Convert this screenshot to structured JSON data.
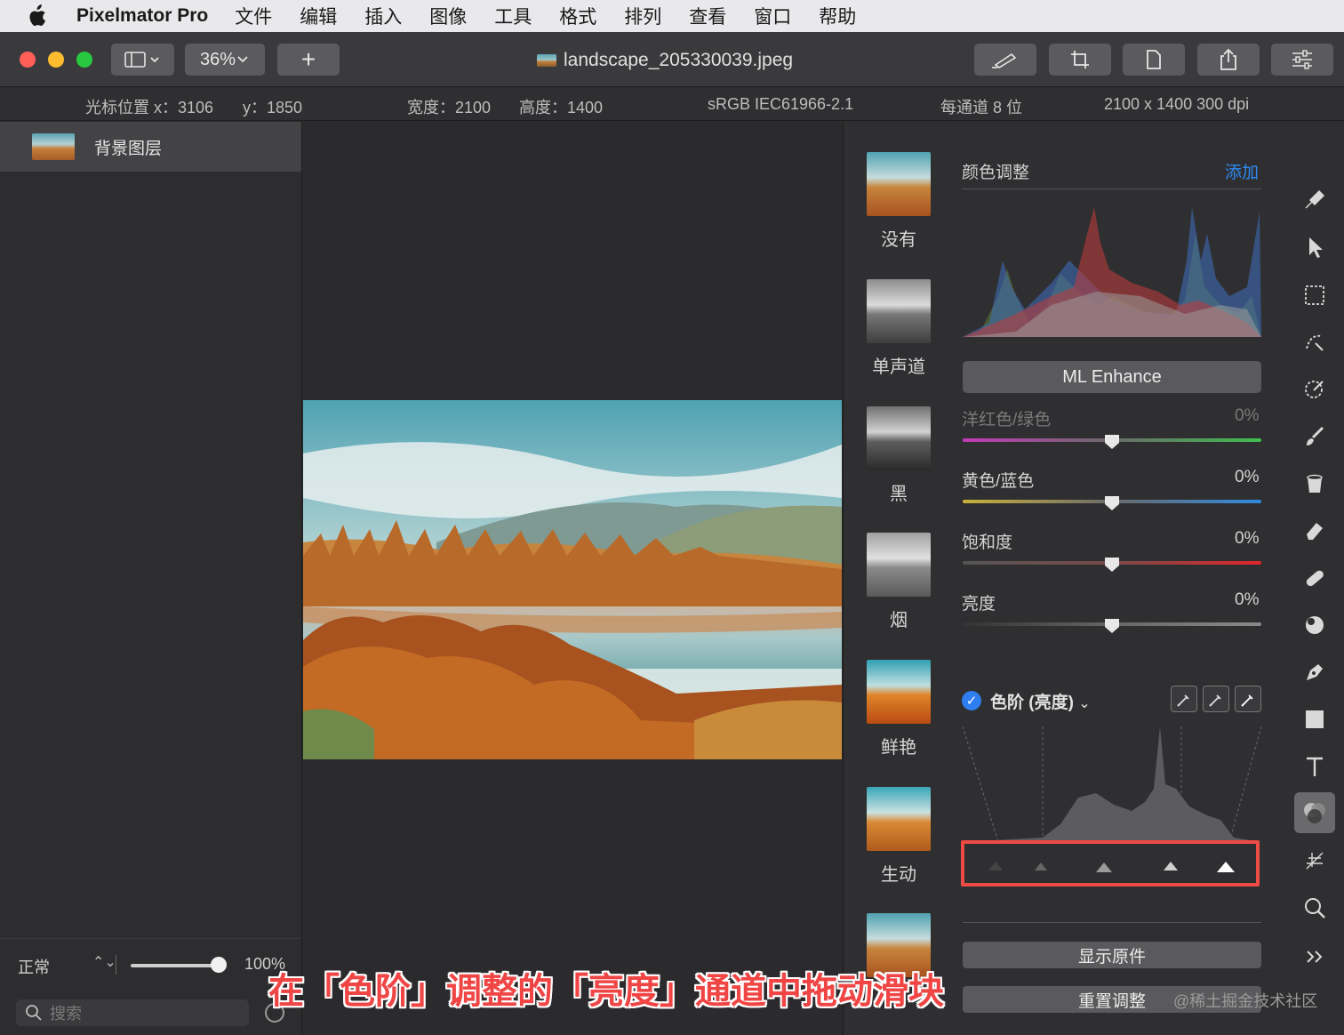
{
  "menubar": {
    "app_name": "Pixelmator Pro",
    "items": [
      "文件",
      "编辑",
      "插入",
      "图像",
      "工具",
      "格式",
      "排列",
      "查看",
      "窗口",
      "帮助"
    ]
  },
  "toolbar": {
    "zoom": "36%",
    "add_label": "+",
    "document_title": "landscape_205330039.jpeg",
    "right_buttons": [
      "pen-icon",
      "crop-icon",
      "document-icon",
      "share-icon",
      "sliders-icon"
    ]
  },
  "infobar": {
    "cursor_x": "光标位置 x：3106",
    "cursor_y": "y：1850",
    "width": "宽度：2100",
    "height": "高度：1400",
    "color_profile": "sRGB IEC61966-2.1",
    "bit_depth": "每通道 8 位",
    "resolution": "2100 x 1400 300 dpi"
  },
  "layers": {
    "items": [
      {
        "name": "背景图层"
      }
    ],
    "blend_mode": "正常",
    "opacity": "100%",
    "opacity_level": 1.0,
    "search_placeholder": "搜索"
  },
  "presets": [
    {
      "label": "没有"
    },
    {
      "label": "单声道"
    },
    {
      "label": "黑"
    },
    {
      "label": "烟"
    },
    {
      "label": "鲜艳"
    },
    {
      "label": "生动"
    }
  ],
  "adjustments": {
    "section_title": "颜色调整",
    "add_label": "添加",
    "ml_enhance": "ML Enhance",
    "sliders": [
      {
        "label": "洋红色/绿色",
        "value": "0%",
        "disabled": true
      },
      {
        "label": "黄色/蓝色",
        "value": "0%",
        "disabled": false
      },
      {
        "label": "饱和度",
        "value": "0%",
        "disabled": false
      },
      {
        "label": "亮度",
        "value": "0%",
        "disabled": false
      }
    ],
    "levels": {
      "title": "色阶 (亮度)",
      "chevron": "⌄"
    },
    "show_original": "显示原件",
    "reset": "重置调整"
  },
  "tools": [
    "style-brush-icon",
    "arrange-pointer-icon",
    "rect-select-icon",
    "smart-select-icon",
    "color-select-icon",
    "paint-brush-icon",
    "fill-bucket-icon",
    "eraser-icon",
    "retouch-bandage-icon",
    "distort-sphere-icon",
    "pen-nib-icon",
    "shape-square-icon",
    "type-icon",
    "color-adjust-icon",
    "effects-icon",
    "zoom-icon",
    "more-chevron-icon"
  ],
  "overlay": {
    "caption": "在「色阶」调整的「亮度」通道中拖动滑块",
    "watermark": "@稀土掘金技术社区"
  },
  "colors": {
    "accent_blue": "#2f8af5",
    "highlight_red": "#ef4b45",
    "traffic_red": "#ff5f57",
    "traffic_yellow": "#febc2e",
    "traffic_green": "#28c840"
  }
}
